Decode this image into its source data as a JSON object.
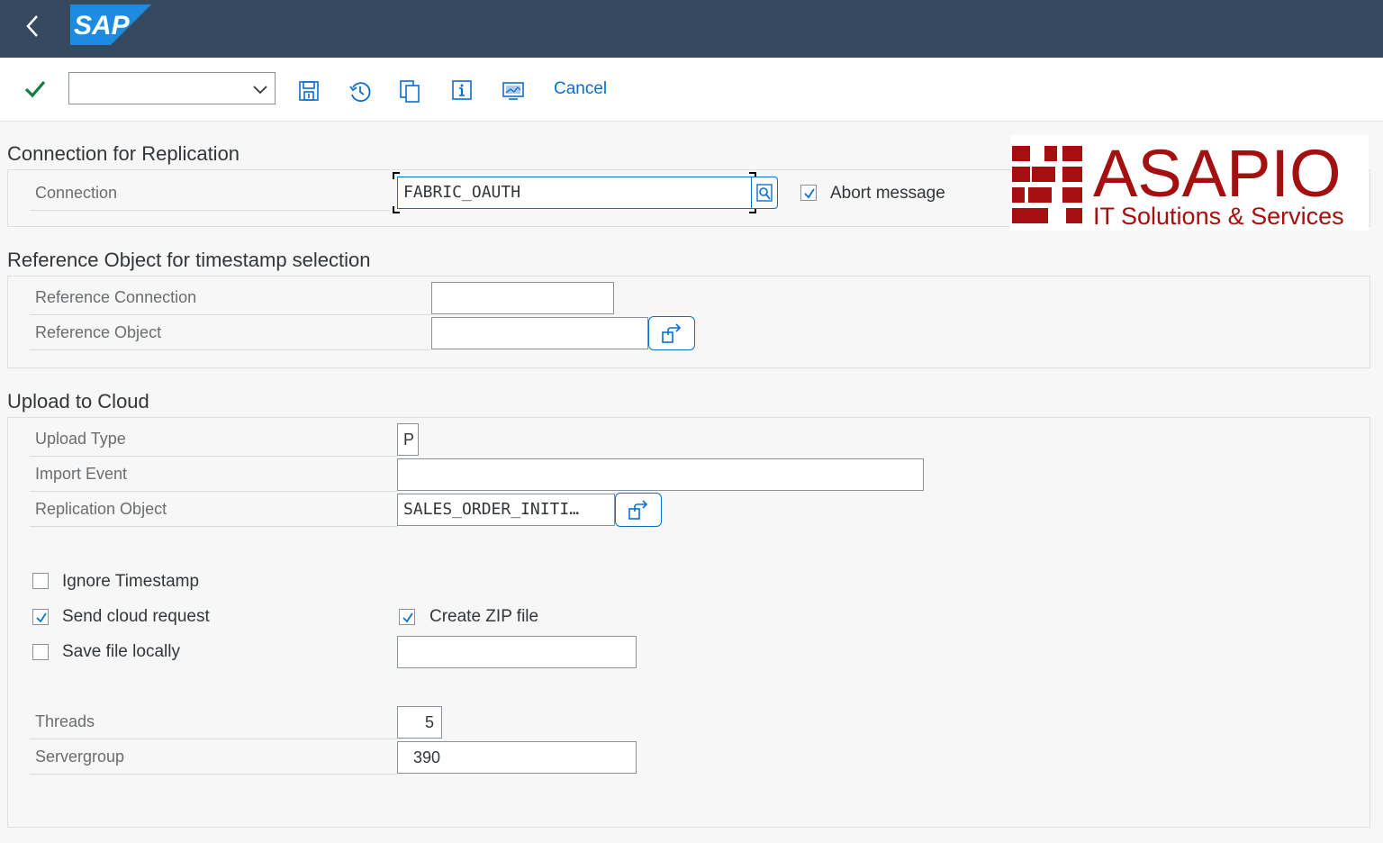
{
  "header": {
    "logo_text": "SAP"
  },
  "toolbar": {
    "select_value": "",
    "cancel_label": "Cancel"
  },
  "connection_section": {
    "title": "Connection for Replication",
    "connection_label": "Connection",
    "connection_value": "FABRIC_OAUTH",
    "abort_message_label": "Abort message",
    "abort_message_checked": true
  },
  "reference_section": {
    "title": "Reference Object for timestamp selection",
    "ref_connection_label": "Reference Connection",
    "ref_connection_value": "",
    "ref_object_label": "Reference Object",
    "ref_object_value": ""
  },
  "upload_section": {
    "title": "Upload to Cloud",
    "upload_type_label": "Upload Type",
    "upload_type_value": "P",
    "import_event_label": "Import Event",
    "import_event_value": "",
    "replication_object_label": "Replication Object",
    "replication_object_value": "SALES_ORDER_INITI…",
    "ignore_timestamp_label": "Ignore Timestamp",
    "ignore_timestamp_checked": false,
    "send_cloud_request_label": "Send cloud request",
    "send_cloud_request_checked": true,
    "create_zip_label": "Create ZIP file",
    "create_zip_checked": true,
    "save_file_locally_label": "Save file locally",
    "save_file_locally_checked": false,
    "save_file_path_value": "",
    "threads_label": "Threads",
    "threads_value": "5",
    "servergroup_label": "Servergroup",
    "servergroup_value": "390"
  },
  "branding": {
    "company_name": "ASAPIO",
    "company_tagline": "IT Solutions & Services",
    "brand_color": "#a40f0f"
  },
  "colors": {
    "shell": "#354a5f",
    "accent": "#0a6ed1",
    "success": "#107e3e"
  }
}
